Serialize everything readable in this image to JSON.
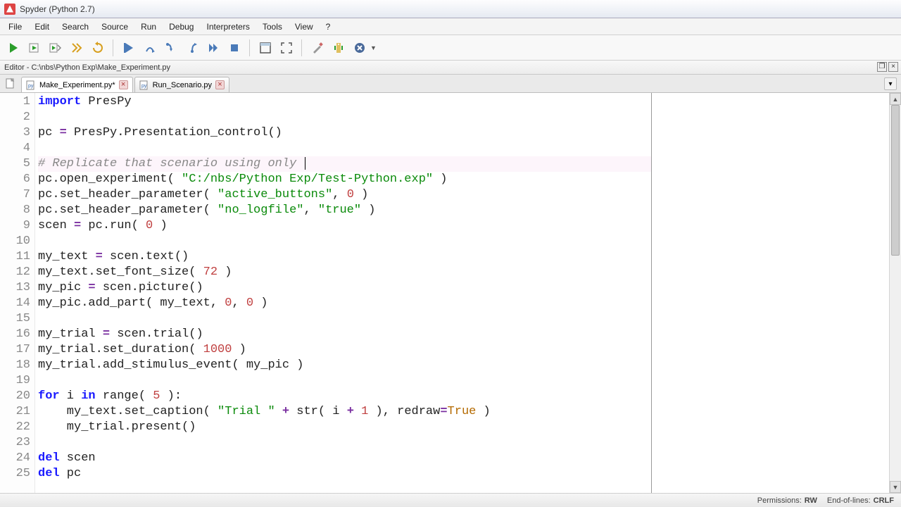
{
  "window": {
    "title": "Spyder (Python 2.7)"
  },
  "menu": {
    "items": [
      "File",
      "Edit",
      "Search",
      "Source",
      "Run",
      "Debug",
      "Interpreters",
      "Tools",
      "View",
      "?"
    ]
  },
  "editor_header": {
    "path": "Editor - C:\\nbs\\Python Exp\\Make_Experiment.py"
  },
  "tabs": {
    "items": [
      {
        "label": "Make_Experiment.py*",
        "active": true
      },
      {
        "label": "Run_Scenario.py",
        "active": false
      }
    ]
  },
  "code": {
    "lines": [
      [
        {
          "c": "kw",
          "t": "import"
        },
        {
          "c": "",
          "t": " PresPy"
        }
      ],
      [],
      [
        {
          "c": "",
          "t": "pc "
        },
        {
          "c": "op",
          "t": "="
        },
        {
          "c": "",
          "t": " PresPy.Presentation_control()"
        }
      ],
      [],
      [
        {
          "c": "cm",
          "t": "# Replicate that scenario using only "
        }
      ],
      [
        {
          "c": "",
          "t": "pc.open_experiment( "
        },
        {
          "c": "str",
          "t": "\"C:/nbs/Python Exp/Test-Python.exp\""
        },
        {
          "c": "",
          "t": " )"
        }
      ],
      [
        {
          "c": "",
          "t": "pc.set_header_parameter( "
        },
        {
          "c": "str",
          "t": "\"active_buttons\""
        },
        {
          "c": "",
          "t": ", "
        },
        {
          "c": "num",
          "t": "0"
        },
        {
          "c": "",
          "t": " )"
        }
      ],
      [
        {
          "c": "",
          "t": "pc.set_header_parameter( "
        },
        {
          "c": "str",
          "t": "\"no_logfile\""
        },
        {
          "c": "",
          "t": ", "
        },
        {
          "c": "str",
          "t": "\"true\""
        },
        {
          "c": "",
          "t": " )"
        }
      ],
      [
        {
          "c": "",
          "t": "scen "
        },
        {
          "c": "op",
          "t": "="
        },
        {
          "c": "",
          "t": " pc.run( "
        },
        {
          "c": "num",
          "t": "0"
        },
        {
          "c": "",
          "t": " )"
        }
      ],
      [],
      [
        {
          "c": "",
          "t": "my_text "
        },
        {
          "c": "op",
          "t": "="
        },
        {
          "c": "",
          "t": " scen.text()"
        }
      ],
      [
        {
          "c": "",
          "t": "my_text.set_font_size( "
        },
        {
          "c": "num",
          "t": "72"
        },
        {
          "c": "",
          "t": " )"
        }
      ],
      [
        {
          "c": "",
          "t": "my_pic "
        },
        {
          "c": "op",
          "t": "="
        },
        {
          "c": "",
          "t": " scen.picture()"
        }
      ],
      [
        {
          "c": "",
          "t": "my_pic.add_part( my_text, "
        },
        {
          "c": "num",
          "t": "0"
        },
        {
          "c": "",
          "t": ", "
        },
        {
          "c": "num",
          "t": "0"
        },
        {
          "c": "",
          "t": " )"
        }
      ],
      [],
      [
        {
          "c": "",
          "t": "my_trial "
        },
        {
          "c": "op",
          "t": "="
        },
        {
          "c": "",
          "t": " scen.trial()"
        }
      ],
      [
        {
          "c": "",
          "t": "my_trial.set_duration( "
        },
        {
          "c": "num",
          "t": "1000"
        },
        {
          "c": "",
          "t": " )"
        }
      ],
      [
        {
          "c": "",
          "t": "my_trial.add_stimulus_event( my_pic )"
        }
      ],
      [],
      [
        {
          "c": "kw",
          "t": "for"
        },
        {
          "c": "",
          "t": " i "
        },
        {
          "c": "kw",
          "t": "in"
        },
        {
          "c": "",
          "t": " range( "
        },
        {
          "c": "num",
          "t": "5"
        },
        {
          "c": "",
          "t": " ):"
        }
      ],
      [
        {
          "c": "",
          "t": "    my_text.set_caption( "
        },
        {
          "c": "str",
          "t": "\"Trial \""
        },
        {
          "c": "",
          "t": " "
        },
        {
          "c": "op",
          "t": "+"
        },
        {
          "c": "",
          "t": " str( i "
        },
        {
          "c": "op",
          "t": "+"
        },
        {
          "c": "",
          "t": " "
        },
        {
          "c": "num",
          "t": "1"
        },
        {
          "c": "",
          "t": " ), redraw"
        },
        {
          "c": "op",
          "t": "="
        },
        {
          "c": "bool",
          "t": "True"
        },
        {
          "c": "",
          "t": " )"
        }
      ],
      [
        {
          "c": "",
          "t": "    my_trial.present()"
        }
      ],
      [],
      [
        {
          "c": "kw",
          "t": "del"
        },
        {
          "c": "",
          "t": " scen"
        }
      ],
      [
        {
          "c": "kw",
          "t": "del"
        },
        {
          "c": "",
          "t": " pc"
        }
      ]
    ],
    "highlight_line": 5,
    "cursor_line": 5
  },
  "status": {
    "permissions_label": "Permissions:",
    "permissions_value": "RW",
    "eol_label": "End-of-lines:",
    "eol_value": "CRLF"
  }
}
